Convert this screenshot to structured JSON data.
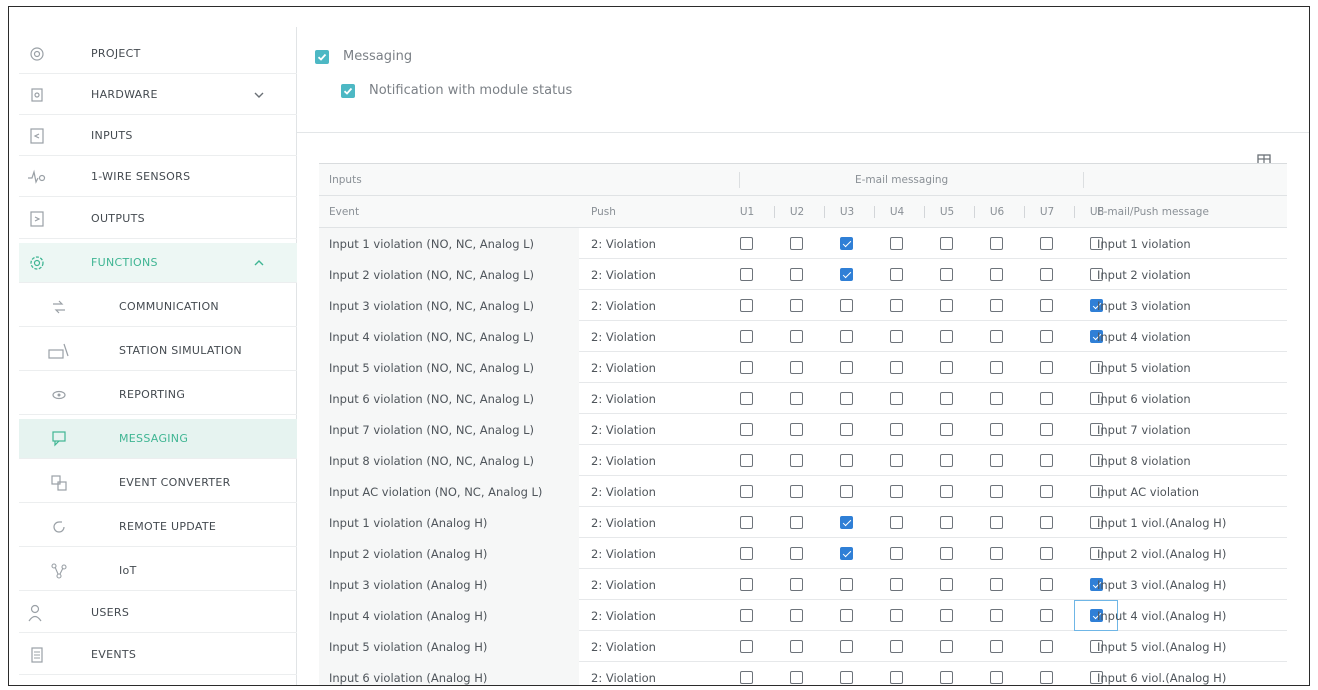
{
  "sidebar": {
    "items": [
      {
        "label": "PROJECT",
        "icon": "project-gear-icon"
      },
      {
        "label": "HARDWARE",
        "icon": "hardware-chip-icon"
      },
      {
        "label": "INPUTS",
        "icon": "inputs-icon"
      },
      {
        "label": "1-WIRE SENSORS",
        "icon": "sensor-icon"
      },
      {
        "label": "OUTPUTS",
        "icon": "outputs-icon"
      },
      {
        "label": "FUNCTIONS",
        "icon": "functions-gear-icon"
      },
      {
        "label": "COMMUNICATION",
        "icon": "communication-icon"
      },
      {
        "label": "STATION SIMULATION",
        "icon": "station-icon"
      },
      {
        "label": "REPORTING",
        "icon": "reporting-eye-icon"
      },
      {
        "label": "MESSAGING",
        "icon": "messaging-icon"
      },
      {
        "label": "EVENT CONVERTER",
        "icon": "event-converter-icon"
      },
      {
        "label": "REMOTE UPDATE",
        "icon": "remote-update-icon"
      },
      {
        "label": "IoT",
        "icon": "iot-icon"
      },
      {
        "label": "USERS",
        "icon": "users-icon"
      },
      {
        "label": "EVENTS",
        "icon": "events-list-icon"
      }
    ],
    "selected": "MESSAGING",
    "accent_color": "#3fb593"
  },
  "main": {
    "messaging_label": "Messaging",
    "messaging_checked": true,
    "notification_label": "Notification with module status",
    "notification_checked": true,
    "table": {
      "group_inputs": "Inputs",
      "group_email": "E-mail messaging",
      "columns": [
        "Event",
        "Push",
        "U1",
        "U2",
        "U3",
        "U4",
        "U5",
        "U6",
        "U7",
        "U8",
        "E-mail/Push message"
      ],
      "rows": [
        {
          "event": "Input 1 violation (NO, NC, Analog L)",
          "push": "2: Violation",
          "checks": [
            false,
            false,
            true,
            false,
            false,
            false,
            false,
            false
          ],
          "message": "Input 1 violation"
        },
        {
          "event": "Input 2 violation (NO, NC, Analog L)",
          "push": "2: Violation",
          "checks": [
            false,
            false,
            true,
            false,
            false,
            false,
            false,
            false
          ],
          "message": "Input 2 violation"
        },
        {
          "event": "Input 3 violation (NO, NC, Analog L)",
          "push": "2: Violation",
          "checks": [
            false,
            false,
            false,
            false,
            false,
            false,
            false,
            true
          ],
          "message": "Input 3 violation"
        },
        {
          "event": "Input 4 violation (NO, NC, Analog L)",
          "push": "2: Violation",
          "checks": [
            false,
            false,
            false,
            false,
            false,
            false,
            false,
            true
          ],
          "message": "Input 4 violation"
        },
        {
          "event": "Input 5 violation (NO, NC, Analog L)",
          "push": "2: Violation",
          "checks": [
            false,
            false,
            false,
            false,
            false,
            false,
            false,
            false
          ],
          "message": "Input 5 violation"
        },
        {
          "event": "Input 6 violation (NO, NC, Analog L)",
          "push": "2: Violation",
          "checks": [
            false,
            false,
            false,
            false,
            false,
            false,
            false,
            false
          ],
          "message": "Input 6 violation"
        },
        {
          "event": "Input 7 violation (NO, NC, Analog L)",
          "push": "2: Violation",
          "checks": [
            false,
            false,
            false,
            false,
            false,
            false,
            false,
            false
          ],
          "message": "Input 7 violation"
        },
        {
          "event": "Input 8 violation (NO, NC, Analog L)",
          "push": "2: Violation",
          "checks": [
            false,
            false,
            false,
            false,
            false,
            false,
            false,
            false
          ],
          "message": "Input 8 violation"
        },
        {
          "event": "Input AC violation (NO, NC, Analog L)",
          "push": "2: Violation",
          "checks": [
            false,
            false,
            false,
            false,
            false,
            false,
            false,
            false
          ],
          "message": "Input AC violation"
        },
        {
          "event": "Input 1 violation (Analog H)",
          "push": "2: Violation",
          "checks": [
            false,
            false,
            true,
            false,
            false,
            false,
            false,
            false
          ],
          "message": "Input 1 viol.(Analog H)"
        },
        {
          "event": "Input 2 violation (Analog H)",
          "push": "2: Violation",
          "checks": [
            false,
            false,
            true,
            false,
            false,
            false,
            false,
            false
          ],
          "message": "Input 2 viol.(Analog H)"
        },
        {
          "event": "Input 3 violation (Analog H)",
          "push": "2: Violation",
          "checks": [
            false,
            false,
            false,
            false,
            false,
            false,
            false,
            true
          ],
          "message": "Input 3 viol.(Analog H)"
        },
        {
          "event": "Input 4 violation (Analog H)",
          "push": "2: Violation",
          "checks": [
            false,
            false,
            false,
            false,
            false,
            false,
            false,
            true
          ],
          "message": "Input 4 viol.(Analog H)",
          "focused": true
        },
        {
          "event": "Input 5 violation (Analog H)",
          "push": "2: Violation",
          "checks": [
            false,
            false,
            false,
            false,
            false,
            false,
            false,
            false
          ],
          "message": "Input 5 viol.(Analog H)"
        },
        {
          "event": "Input 6 violation (Analog H)",
          "push": "2: Violation",
          "checks": [
            false,
            false,
            false,
            false,
            false,
            false,
            false,
            false
          ],
          "message": "Input 6 viol.(Analog H)"
        }
      ]
    },
    "checkbox_on_color": "#2f7fd6",
    "toggle_color": "#4db8c4"
  }
}
